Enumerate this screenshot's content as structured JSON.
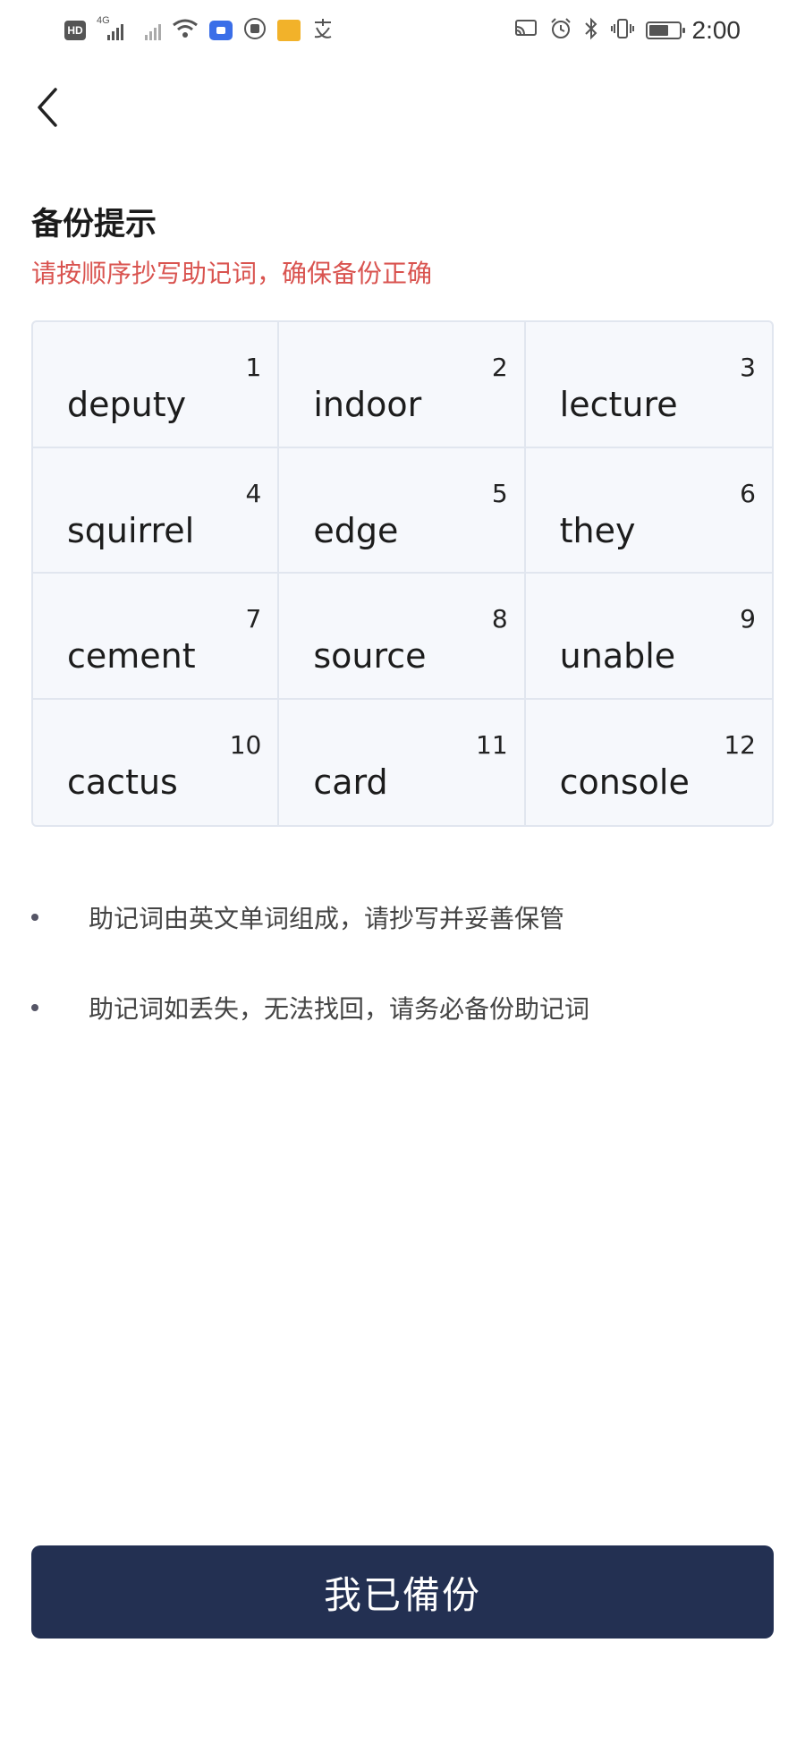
{
  "status_bar": {
    "left_icons": [
      "hd-icon",
      "signal-4g-icon",
      "signal-icon",
      "wifi-icon",
      "video-app-icon",
      "hand-app-icon",
      "yellow-app-icon",
      "alipay-icon"
    ],
    "right_icons": [
      "cast-icon",
      "alarm-icon",
      "bluetooth-icon",
      "vibrate-icon",
      "battery-icon"
    ],
    "time": "2:00",
    "hd_label": "HD",
    "network_label": "4G"
  },
  "header": {
    "back_icon": "chevron-left-icon"
  },
  "content": {
    "title": "备份提示",
    "warning": "请按顺序抄写助记词，确保备份正确",
    "warning_color": "#d9534f"
  },
  "mnemonic": {
    "words": [
      {
        "index": "1",
        "word": "deputy"
      },
      {
        "index": "2",
        "word": "indoor"
      },
      {
        "index": "3",
        "word": "lecture"
      },
      {
        "index": "4",
        "word": "squirrel"
      },
      {
        "index": "5",
        "word": "edge"
      },
      {
        "index": "6",
        "word": "they"
      },
      {
        "index": "7",
        "word": "cement"
      },
      {
        "index": "8",
        "word": "source"
      },
      {
        "index": "9",
        "word": "unable"
      },
      {
        "index": "10",
        "word": "cactus"
      },
      {
        "index": "11",
        "word": "card"
      },
      {
        "index": "12",
        "word": "console"
      }
    ]
  },
  "tips": [
    "助记词由英文单词组成，请抄写并妥善保管",
    "助记词如丢失，无法找回，请务必备份助记词"
  ],
  "footer": {
    "confirm_label": "我已備份",
    "button_color": "#233052"
  }
}
